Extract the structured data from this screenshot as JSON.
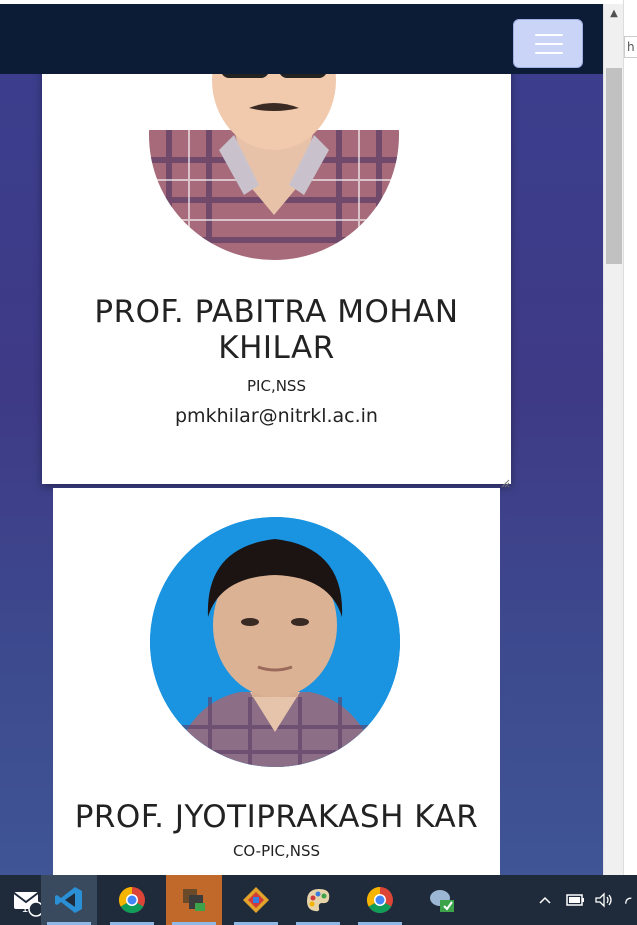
{
  "navbar": {
    "menu_button": "toggle-navigation"
  },
  "cards": [
    {
      "name": "PROF. PABITRA MOHAN KHILAR",
      "role": "PIC,NSS",
      "email": "pmkhilar@nitrkl.ac.in"
    },
    {
      "name": "PROF. JYOTIPRAKASH KAR",
      "role": "CO-PIC,NSS"
    }
  ],
  "side_panel": {
    "fragment": "h I"
  },
  "taskbar": {
    "mail_badge": "1",
    "items": [
      "mail-icon",
      "vscode-icon",
      "chrome-icon",
      "app-icon",
      "app-icon",
      "paint-icon",
      "chrome-icon",
      "app-icon"
    ],
    "tray_chevron": "^"
  },
  "colors": {
    "navbar": "#0c1b36",
    "background": "#3e3a86",
    "toggler": "#c9d4f6",
    "taskbar": "#1f2b3a"
  }
}
